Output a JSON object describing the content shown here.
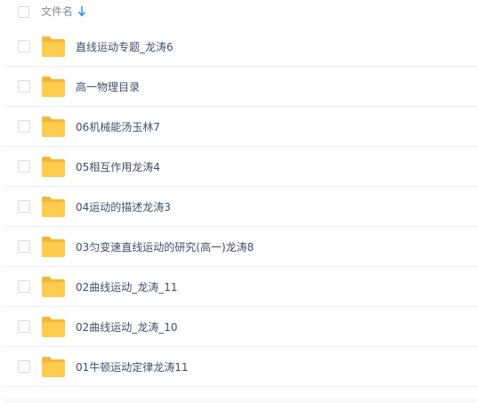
{
  "header": {
    "column_label": "文件名",
    "sort_icon": "arrow-down-icon",
    "accent_color": "#3b8cff"
  },
  "folder_color": "#ffcc4d",
  "files": [
    {
      "name": "直线运动专题_龙涛6",
      "icon": "folder-icon"
    },
    {
      "name": "高一物理目录",
      "icon": "folder-icon"
    },
    {
      "name": "06机械能汤玉林7",
      "icon": "folder-icon"
    },
    {
      "name": "05相互作用龙涛4",
      "icon": "folder-icon"
    },
    {
      "name": "04运动的描述龙涛3",
      "icon": "folder-icon"
    },
    {
      "name": "03匀变速直线运动的研究(高一)龙涛8",
      "icon": "folder-icon"
    },
    {
      "name": "02曲线运动_龙涛_11",
      "icon": "folder-icon"
    },
    {
      "name": "02曲线运动_龙涛_10",
      "icon": "folder-icon"
    },
    {
      "name": "01牛顿运动定律龙涛11",
      "icon": "folder-icon"
    }
  ]
}
